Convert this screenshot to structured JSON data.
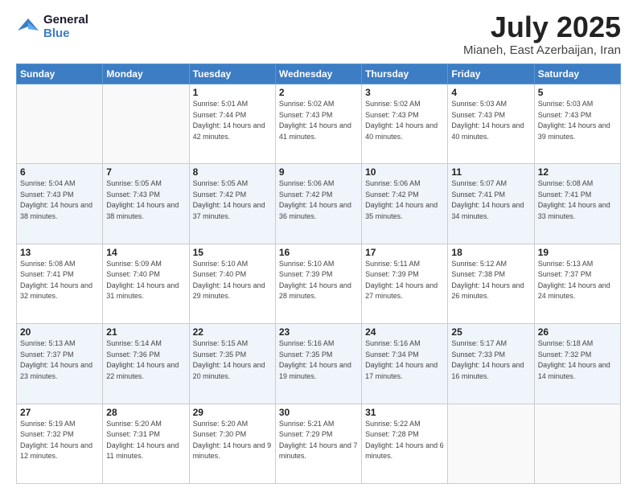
{
  "logo": {
    "line1": "General",
    "line2": "Blue"
  },
  "header": {
    "month": "July 2025",
    "location": "Mianeh, East Azerbaijan, Iran"
  },
  "weekdays": [
    "Sunday",
    "Monday",
    "Tuesday",
    "Wednesday",
    "Thursday",
    "Friday",
    "Saturday"
  ],
  "weeks": [
    [
      {
        "day": "",
        "sunrise": "",
        "sunset": "",
        "daylight": ""
      },
      {
        "day": "",
        "sunrise": "",
        "sunset": "",
        "daylight": ""
      },
      {
        "day": "1",
        "sunrise": "Sunrise: 5:01 AM",
        "sunset": "Sunset: 7:44 PM",
        "daylight": "Daylight: 14 hours and 42 minutes."
      },
      {
        "day": "2",
        "sunrise": "Sunrise: 5:02 AM",
        "sunset": "Sunset: 7:43 PM",
        "daylight": "Daylight: 14 hours and 41 minutes."
      },
      {
        "day": "3",
        "sunrise": "Sunrise: 5:02 AM",
        "sunset": "Sunset: 7:43 PM",
        "daylight": "Daylight: 14 hours and 40 minutes."
      },
      {
        "day": "4",
        "sunrise": "Sunrise: 5:03 AM",
        "sunset": "Sunset: 7:43 PM",
        "daylight": "Daylight: 14 hours and 40 minutes."
      },
      {
        "day": "5",
        "sunrise": "Sunrise: 5:03 AM",
        "sunset": "Sunset: 7:43 PM",
        "daylight": "Daylight: 14 hours and 39 minutes."
      }
    ],
    [
      {
        "day": "6",
        "sunrise": "Sunrise: 5:04 AM",
        "sunset": "Sunset: 7:43 PM",
        "daylight": "Daylight: 14 hours and 38 minutes."
      },
      {
        "day": "7",
        "sunrise": "Sunrise: 5:05 AM",
        "sunset": "Sunset: 7:43 PM",
        "daylight": "Daylight: 14 hours and 38 minutes."
      },
      {
        "day": "8",
        "sunrise": "Sunrise: 5:05 AM",
        "sunset": "Sunset: 7:42 PM",
        "daylight": "Daylight: 14 hours and 37 minutes."
      },
      {
        "day": "9",
        "sunrise": "Sunrise: 5:06 AM",
        "sunset": "Sunset: 7:42 PM",
        "daylight": "Daylight: 14 hours and 36 minutes."
      },
      {
        "day": "10",
        "sunrise": "Sunrise: 5:06 AM",
        "sunset": "Sunset: 7:42 PM",
        "daylight": "Daylight: 14 hours and 35 minutes."
      },
      {
        "day": "11",
        "sunrise": "Sunrise: 5:07 AM",
        "sunset": "Sunset: 7:41 PM",
        "daylight": "Daylight: 14 hours and 34 minutes."
      },
      {
        "day": "12",
        "sunrise": "Sunrise: 5:08 AM",
        "sunset": "Sunset: 7:41 PM",
        "daylight": "Daylight: 14 hours and 33 minutes."
      }
    ],
    [
      {
        "day": "13",
        "sunrise": "Sunrise: 5:08 AM",
        "sunset": "Sunset: 7:41 PM",
        "daylight": "Daylight: 14 hours and 32 minutes."
      },
      {
        "day": "14",
        "sunrise": "Sunrise: 5:09 AM",
        "sunset": "Sunset: 7:40 PM",
        "daylight": "Daylight: 14 hours and 31 minutes."
      },
      {
        "day": "15",
        "sunrise": "Sunrise: 5:10 AM",
        "sunset": "Sunset: 7:40 PM",
        "daylight": "Daylight: 14 hours and 29 minutes."
      },
      {
        "day": "16",
        "sunrise": "Sunrise: 5:10 AM",
        "sunset": "Sunset: 7:39 PM",
        "daylight": "Daylight: 14 hours and 28 minutes."
      },
      {
        "day": "17",
        "sunrise": "Sunrise: 5:11 AM",
        "sunset": "Sunset: 7:39 PM",
        "daylight": "Daylight: 14 hours and 27 minutes."
      },
      {
        "day": "18",
        "sunrise": "Sunrise: 5:12 AM",
        "sunset": "Sunset: 7:38 PM",
        "daylight": "Daylight: 14 hours and 26 minutes."
      },
      {
        "day": "19",
        "sunrise": "Sunrise: 5:13 AM",
        "sunset": "Sunset: 7:37 PM",
        "daylight": "Daylight: 14 hours and 24 minutes."
      }
    ],
    [
      {
        "day": "20",
        "sunrise": "Sunrise: 5:13 AM",
        "sunset": "Sunset: 7:37 PM",
        "daylight": "Daylight: 14 hours and 23 minutes."
      },
      {
        "day": "21",
        "sunrise": "Sunrise: 5:14 AM",
        "sunset": "Sunset: 7:36 PM",
        "daylight": "Daylight: 14 hours and 22 minutes."
      },
      {
        "day": "22",
        "sunrise": "Sunrise: 5:15 AM",
        "sunset": "Sunset: 7:35 PM",
        "daylight": "Daylight: 14 hours and 20 minutes."
      },
      {
        "day": "23",
        "sunrise": "Sunrise: 5:16 AM",
        "sunset": "Sunset: 7:35 PM",
        "daylight": "Daylight: 14 hours and 19 minutes."
      },
      {
        "day": "24",
        "sunrise": "Sunrise: 5:16 AM",
        "sunset": "Sunset: 7:34 PM",
        "daylight": "Daylight: 14 hours and 17 minutes."
      },
      {
        "day": "25",
        "sunrise": "Sunrise: 5:17 AM",
        "sunset": "Sunset: 7:33 PM",
        "daylight": "Daylight: 14 hours and 16 minutes."
      },
      {
        "day": "26",
        "sunrise": "Sunrise: 5:18 AM",
        "sunset": "Sunset: 7:32 PM",
        "daylight": "Daylight: 14 hours and 14 minutes."
      }
    ],
    [
      {
        "day": "27",
        "sunrise": "Sunrise: 5:19 AM",
        "sunset": "Sunset: 7:32 PM",
        "daylight": "Daylight: 14 hours and 12 minutes."
      },
      {
        "day": "28",
        "sunrise": "Sunrise: 5:20 AM",
        "sunset": "Sunset: 7:31 PM",
        "daylight": "Daylight: 14 hours and 11 minutes."
      },
      {
        "day": "29",
        "sunrise": "Sunrise: 5:20 AM",
        "sunset": "Sunset: 7:30 PM",
        "daylight": "Daylight: 14 hours and 9 minutes."
      },
      {
        "day": "30",
        "sunrise": "Sunrise: 5:21 AM",
        "sunset": "Sunset: 7:29 PM",
        "daylight": "Daylight: 14 hours and 7 minutes."
      },
      {
        "day": "31",
        "sunrise": "Sunrise: 5:22 AM",
        "sunset": "Sunset: 7:28 PM",
        "daylight": "Daylight: 14 hours and 6 minutes."
      },
      {
        "day": "",
        "sunrise": "",
        "sunset": "",
        "daylight": ""
      },
      {
        "day": "",
        "sunrise": "",
        "sunset": "",
        "daylight": ""
      }
    ]
  ]
}
